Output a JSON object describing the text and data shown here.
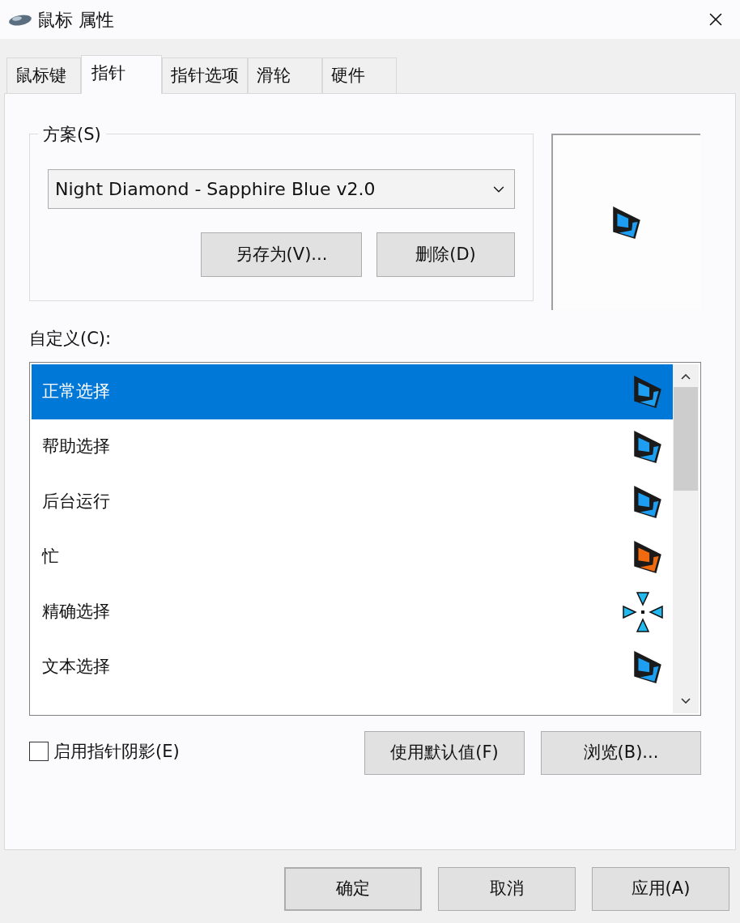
{
  "window": {
    "title": "鼠标 属性"
  },
  "tabs": [
    {
      "label": "鼠标键",
      "selected": false
    },
    {
      "label": "指针",
      "selected": true
    },
    {
      "label": "指针选项",
      "selected": false
    },
    {
      "label": "滑轮",
      "selected": false
    },
    {
      "label": "硬件",
      "selected": false
    }
  ],
  "scheme": {
    "legend": "方案(S)",
    "value": "Night Diamond - Sapphire Blue v2.0",
    "buttons": [
      "另存为(V)...",
      "删除(D)"
    ]
  },
  "customize": {
    "label": "自定义(C):",
    "items": [
      {
        "name": "正常选择",
        "selected": true,
        "kind": "pointer",
        "color": "#1e9ef0"
      },
      {
        "name": "帮助选择",
        "selected": false,
        "kind": "pointer",
        "color": "#1e9ef0"
      },
      {
        "name": "后台运行",
        "selected": false,
        "kind": "pointer",
        "color": "#1e9ef0"
      },
      {
        "name": "忙",
        "selected": false,
        "kind": "pointer",
        "color": "#f26a10"
      },
      {
        "name": "精确选择",
        "selected": false,
        "kind": "crosshair",
        "color": "#22b8f0"
      },
      {
        "name": "文本选择",
        "selected": false,
        "kind": "pointer",
        "color": "#1e9ef0"
      }
    ]
  },
  "shadow": {
    "label": "启用指针阴影(E)",
    "checked": false
  },
  "list_buttons": [
    "使用默认值(F)",
    "浏览(B)..."
  ],
  "footer_buttons": [
    {
      "label": "确定",
      "default": true
    },
    {
      "label": "取消",
      "default": false
    },
    {
      "label": "应用(A)",
      "default": false
    }
  ]
}
